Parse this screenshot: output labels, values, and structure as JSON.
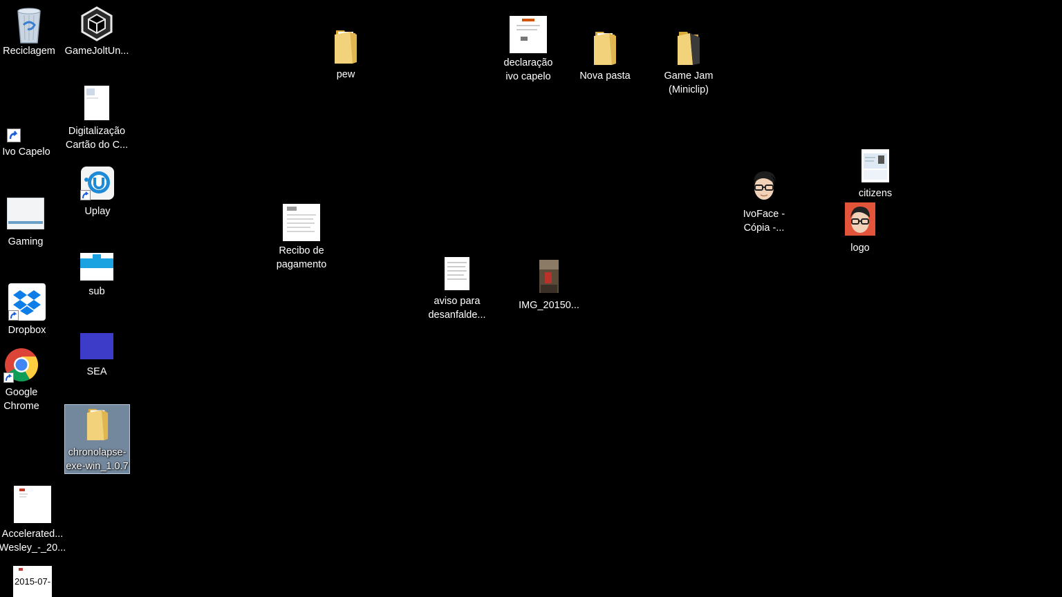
{
  "desktop": {
    "icons": {
      "recycle_bin": {
        "l1": "Reciclagem",
        "l2": ""
      },
      "gamejolt": {
        "l1": "GameJoltUn...",
        "l2": ""
      },
      "digitalizacao": {
        "l1": "Digitalização",
        "l2": "Cartão do C..."
      },
      "ivo_capelo": {
        "l1": "Ivo Capelo",
        "l2": ""
      },
      "uplay": {
        "l1": "Uplay",
        "l2": ""
      },
      "gaming": {
        "l1": "Gaming",
        "l2": ""
      },
      "sub": {
        "l1": "sub",
        "l2": ""
      },
      "dropbox": {
        "l1": "Dropbox",
        "l2": ""
      },
      "sea": {
        "l1": "SEA",
        "l2": ""
      },
      "chrome": {
        "l1": "Google",
        "l2": "Chrome"
      },
      "chronolapse": {
        "l1": "chronolapse-",
        "l2": "exe-win_1.0.7"
      },
      "accelerated": {
        "l1": "Accelerated...",
        "l2": "Wesley_-_20..."
      },
      "date_file": {
        "l1": "2015-07-",
        "l2": ""
      },
      "pew": {
        "l1": "pew",
        "l2": ""
      },
      "declaracao": {
        "l1": "declaração",
        "l2": "ivo capelo"
      },
      "nova_pasta": {
        "l1": "Nova pasta",
        "l2": ""
      },
      "game_jam": {
        "l1": "Game Jam",
        "l2": "(Miniclip)"
      },
      "citizens": {
        "l1": "citizens",
        "l2": ""
      },
      "ivoface": {
        "l1": "IvoFace -",
        "l2": "Cópia -..."
      },
      "logo": {
        "l1": "logo",
        "l2": ""
      },
      "recibo": {
        "l1": "Recibo de",
        "l2": "pagamento"
      },
      "aviso": {
        "l1": "aviso para",
        "l2": "desanfalde..."
      },
      "img": {
        "l1": "IMG_20150...",
        "l2": ""
      }
    }
  },
  "colors": {
    "background": "#000000",
    "folder": "#e8c15a",
    "selection": "#99b4d1",
    "sea_tile": "#3c3cc8",
    "sub_tile": "#1aa3e0",
    "uplay": "#1f8ad6",
    "dropbox": "#0d7ee8",
    "logo_bg": "#e3553a"
  }
}
